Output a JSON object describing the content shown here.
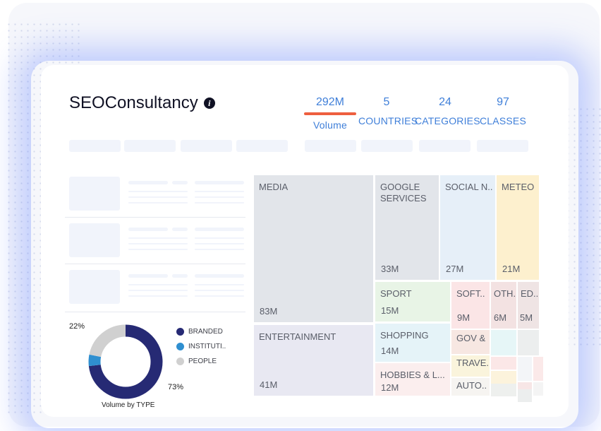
{
  "header": {
    "title": "SEOConsultancy",
    "info_icon": "info-icon"
  },
  "stats": [
    {
      "value": "292M",
      "label": "Volume",
      "active": true
    },
    {
      "value": "5",
      "label": "COUNTRIES"
    },
    {
      "value": "24",
      "label": "CATEGORIES"
    },
    {
      "value": "97",
      "label": "CLASSES"
    }
  ],
  "accent_color": "#3f7fd9",
  "active_underline_color": "#ee5f3f",
  "donut": {
    "caption": "Volume by TYPE",
    "slices": [
      {
        "name": "BRANDED",
        "percent": 73,
        "label": "73%",
        "color": "#262a74"
      },
      {
        "name": "INSTITUTI..",
        "percent": 5,
        "label": "",
        "color": "#2f8fd0"
      },
      {
        "name": "PEOPLE",
        "percent": 22,
        "label": "22%",
        "color": "#d0d0d0"
      }
    ]
  },
  "treemap": {
    "tiles": [
      {
        "label": "MEDIA",
        "value": "83M"
      },
      {
        "label": "ENTERTAINMENT",
        "value": "41M"
      },
      {
        "label": "GOOGLE SERVICES",
        "value": "33M"
      },
      {
        "label": "SOCIAL N..",
        "value": "27M"
      },
      {
        "label": "METEO",
        "value": "21M"
      },
      {
        "label": "SPORT",
        "value": "15M"
      },
      {
        "label": "SOFT..",
        "value": "9M"
      },
      {
        "label": "OTH..",
        "value": "6M"
      },
      {
        "label": "ED..",
        "value": "5M"
      },
      {
        "label": "SHOPPING",
        "value": "14M"
      },
      {
        "label": "GOV &",
        "value": ""
      },
      {
        "label": "TRAVE..",
        "value": ""
      },
      {
        "label": "HOBBIES & L...",
        "value": "12M"
      },
      {
        "label": "AUTO..",
        "value": ""
      }
    ]
  }
}
